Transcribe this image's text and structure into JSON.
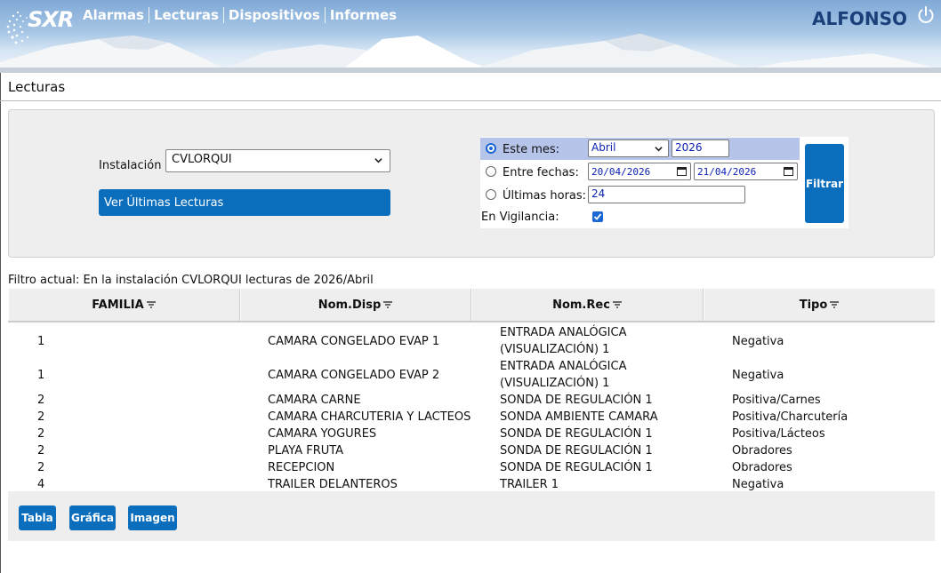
{
  "header": {
    "logo": "SXR",
    "nav": [
      "Alarmas",
      "Lecturas",
      "Dispositivos",
      "Informes"
    ],
    "user": "ALFONSO",
    "icon_power": "power-icon"
  },
  "page_title": "Lecturas",
  "filter": {
    "instalacion_label": "Instalación",
    "instalacion_value": "CVLORQUI",
    "ver_ultimas_label": "Ver Últimas Lecturas",
    "este_mes_label": "Este mes:",
    "mes_value": "Abril",
    "anio_value": "2026",
    "entre_fechas_label": "Entre fechas:",
    "fecha_desde": "20/04/2026",
    "fecha_hasta": "21/04/2026",
    "ultimas_horas_label": "Últimas horas:",
    "ultimas_horas_value": "24",
    "vigilancia_label": "En Vigilancia:",
    "vigilancia_checked": true,
    "filtrar_label": "Filtrar",
    "selected_option": "este_mes"
  },
  "filtro_actual": "Filtro actual: En la instalación CVLORQUI lecturas de 2026/Abril",
  "table": {
    "headers": [
      "FAMILIA",
      "Nom.Disp",
      "Nom.Rec",
      "Tipo"
    ],
    "rows": [
      [
        "1",
        "CAMARA CONGELADO EVAP 1",
        "ENTRADA ANALÓGICA\n(VISUALIZACIÓN) 1",
        "Negativa"
      ],
      [
        "1",
        "CAMARA CONGELADO EVAP 2",
        "ENTRADA ANALÓGICA\n(VISUALIZACIÓN) 1",
        "Negativa"
      ],
      [
        "2",
        "CAMARA CARNE",
        "SONDA DE REGULACIÓN 1",
        "Positiva/Carnes"
      ],
      [
        "2",
        "CAMARA CHARCUTERIA Y LACTEOS",
        "SONDA AMBIENTE CAMARA",
        "Positiva/Charcutería"
      ],
      [
        "2",
        "CAMARA YOGURES",
        "SONDA DE REGULACIÓN 1",
        "Positiva/Lácteos"
      ],
      [
        "2",
        "PLAYA FRUTA",
        "SONDA DE REGULACIÓN 1",
        "Obradores"
      ],
      [
        "2",
        "RECEPCION",
        "SONDA DE REGULACIÓN 1",
        "Obradores"
      ],
      [
        "4",
        "TRAILER DELANTEROS",
        "TRAILER 1",
        "Negativa"
      ]
    ]
  },
  "footer_buttons": [
    "Tabla",
    "Gráfica",
    "Imagen"
  ],
  "colors": {
    "accent": "#0a6ebd",
    "user": "#1b3f79",
    "highlight": "#b7c4ea"
  }
}
